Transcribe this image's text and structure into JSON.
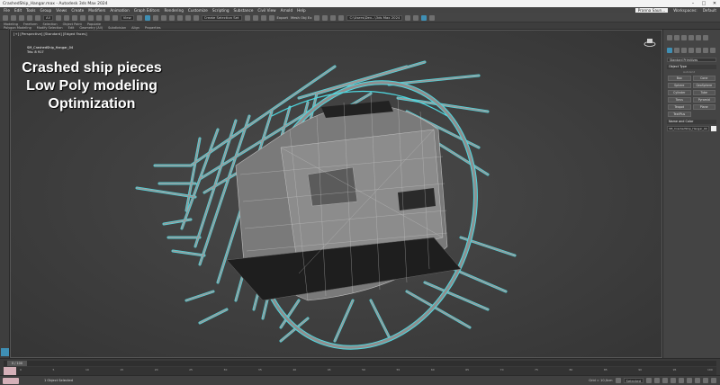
{
  "window": {
    "title": "CrashedShip_Hangar.max - Autodesk 3ds Max 2024",
    "controls": [
      "–",
      "□",
      "✕"
    ]
  },
  "menubar": {
    "items": [
      "File",
      "Edit",
      "Tools",
      "Group",
      "Views",
      "Create",
      "Modifiers",
      "Animation",
      "Graph Editors",
      "Rendering",
      "Customize",
      "Scripting",
      "Substance",
      "Civil View",
      "Arnold",
      "Help"
    ],
    "user": "Pranna Saun...",
    "workspaces_label": "Workspaces:",
    "workspace_value": "Default"
  },
  "toolbar": {
    "view_select": "View",
    "selection_set": "Create Selection Set",
    "export_label": "Export",
    "mesh_label": "Mesh Obj Ex",
    "lib_select": "C:\\Users\\Dev...\\3ds Max 2024"
  },
  "ribbon": {
    "tabs": [
      "Modeling",
      "Freeform",
      "Selection",
      "Object Paint",
      "Populate"
    ],
    "subtabs": [
      "Polygon Modeling",
      "Modify Selection",
      "Edit",
      "Geometry (All)",
      "Subdivision",
      "Align",
      "Properties"
    ]
  },
  "viewport": {
    "label": "[+] [Perspective] [Standard] [Edged Faces]",
    "object_name": "SM_CrashedShip_Hangar_04",
    "tris_label": "Tris:",
    "tris_value": "8 917",
    "overlay": [
      "Crashed ship pieces",
      "Low Poly modeling",
      "Optimization"
    ]
  },
  "command_panel": {
    "category": "Standard Primitives",
    "object_type_header": "Object Type",
    "autogrid": "AutoGrid",
    "buttons": [
      "Box",
      "Cone",
      "Sphere",
      "GeoSphere",
      "Cylinder",
      "Tube",
      "Torus",
      "Pyramid",
      "Teapot",
      "Plane",
      "TextPlus"
    ],
    "name_color_header": "Name and Color",
    "name_value": "SM_CrashedShip_Hangar_04",
    "object_color": "#f0f0f0"
  },
  "timeline": {
    "frame_display": "0 / 100",
    "ticks": [
      "0",
      "5",
      "10",
      "15",
      "20",
      "25",
      "30",
      "35",
      "40",
      "45",
      "50",
      "55",
      "60",
      "65",
      "70",
      "75",
      "80",
      "85",
      "90",
      "95",
      "100"
    ]
  },
  "statusbar": {
    "selection_text": "1 Object Selected",
    "grid_label": "Grid = 10,0cm",
    "selected_label": "Selected"
  },
  "colors": {
    "wire_selected": "#4fd8e0",
    "mesh_fill": "#8a8a8a",
    "accent_blue": "#3f8fb4"
  }
}
